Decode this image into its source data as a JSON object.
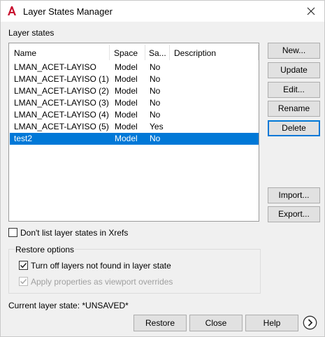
{
  "window": {
    "title": "Layer States Manager",
    "icon": "autocad-a-icon"
  },
  "section_label": "Layer states",
  "table": {
    "columns": [
      "Name",
      "Space",
      "Sa...",
      "Description"
    ],
    "rows": [
      {
        "name": "LMAN_ACET-LAYISO",
        "space": "Model",
        "saved": "No",
        "description": ""
      },
      {
        "name": "LMAN_ACET-LAYISO (1)",
        "space": "Model",
        "saved": "No",
        "description": ""
      },
      {
        "name": "LMAN_ACET-LAYISO (2)",
        "space": "Model",
        "saved": "No",
        "description": ""
      },
      {
        "name": "LMAN_ACET-LAYISO (3)",
        "space": "Model",
        "saved": "No",
        "description": ""
      },
      {
        "name": "LMAN_ACET-LAYISO (4)",
        "space": "Model",
        "saved": "No",
        "description": ""
      },
      {
        "name": "LMAN_ACET-LAYISO (5)",
        "space": "Model",
        "saved": "Yes",
        "description": ""
      },
      {
        "name": "test2",
        "space": "Model",
        "saved": "No",
        "description": "",
        "selected": true
      }
    ]
  },
  "side_buttons": {
    "new": "New...",
    "update": "Update",
    "edit": "Edit...",
    "rename": "Rename",
    "delete": "Delete",
    "import": "Import...",
    "export": "Export..."
  },
  "options": {
    "dont_list_xrefs": {
      "label": "Don't list layer states in Xrefs",
      "checked": false
    },
    "restore_options_label": "Restore options",
    "turn_off_layers": {
      "label": "Turn off layers not found in layer state",
      "checked": true
    },
    "apply_viewport_overrides": {
      "label": "Apply properties as viewport overrides",
      "checked": true,
      "enabled": false
    }
  },
  "status": {
    "current_layer_state": "Current layer state: *UNSAVED*"
  },
  "bottom_buttons": {
    "restore": "Restore",
    "close": "Close",
    "help": "Help"
  },
  "colors": {
    "selection": "#0078d7",
    "app_icon_red": "#c8102e"
  }
}
